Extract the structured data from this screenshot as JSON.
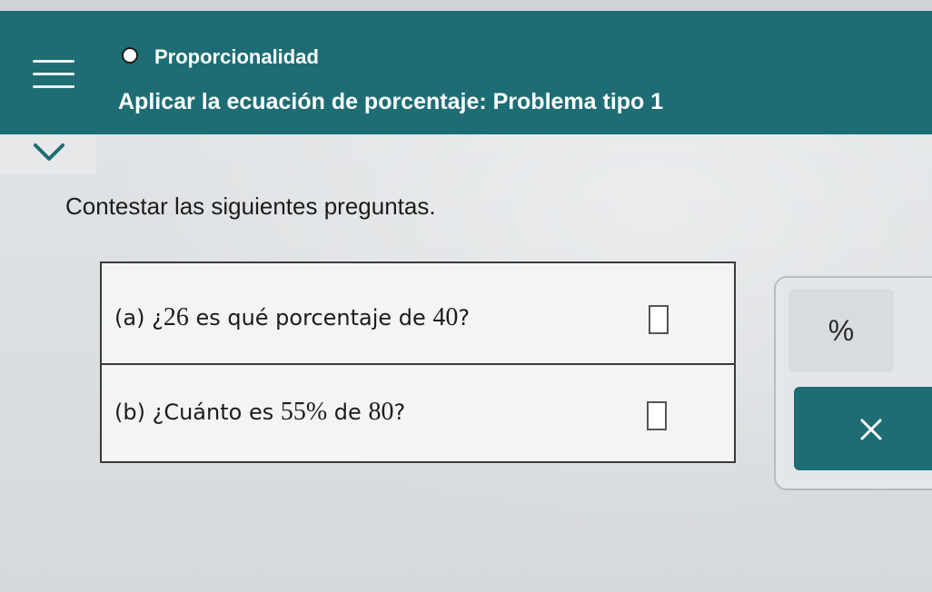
{
  "header": {
    "topic": "Proporcionalidad",
    "title": "Aplicar la ecuación de porcentaje: Problema tipo 1"
  },
  "icons": {
    "menu": "hamburger-menu-icon",
    "topic_status": "circle-icon",
    "collapse": "chevron-down-icon",
    "clear": "close-icon"
  },
  "colors": {
    "header_bg": "#1e6d75",
    "clear_button_bg": "#1e6d75"
  },
  "main": {
    "instructions": "Contestar las siguientes preguntas.",
    "questions": [
      {
        "label": "(a) ¿",
        "math": "26",
        "text_mid": " es qué porcentaje de ",
        "math2": "40",
        "text_end": "?",
        "answer": ""
      },
      {
        "label": "(b) ¿Cuánto es ",
        "math": "55%",
        "text_mid": " de ",
        "math2": "80",
        "text_end": "?",
        "answer": ""
      }
    ]
  },
  "tools": {
    "percent_label": "%",
    "clear_label": "×"
  }
}
